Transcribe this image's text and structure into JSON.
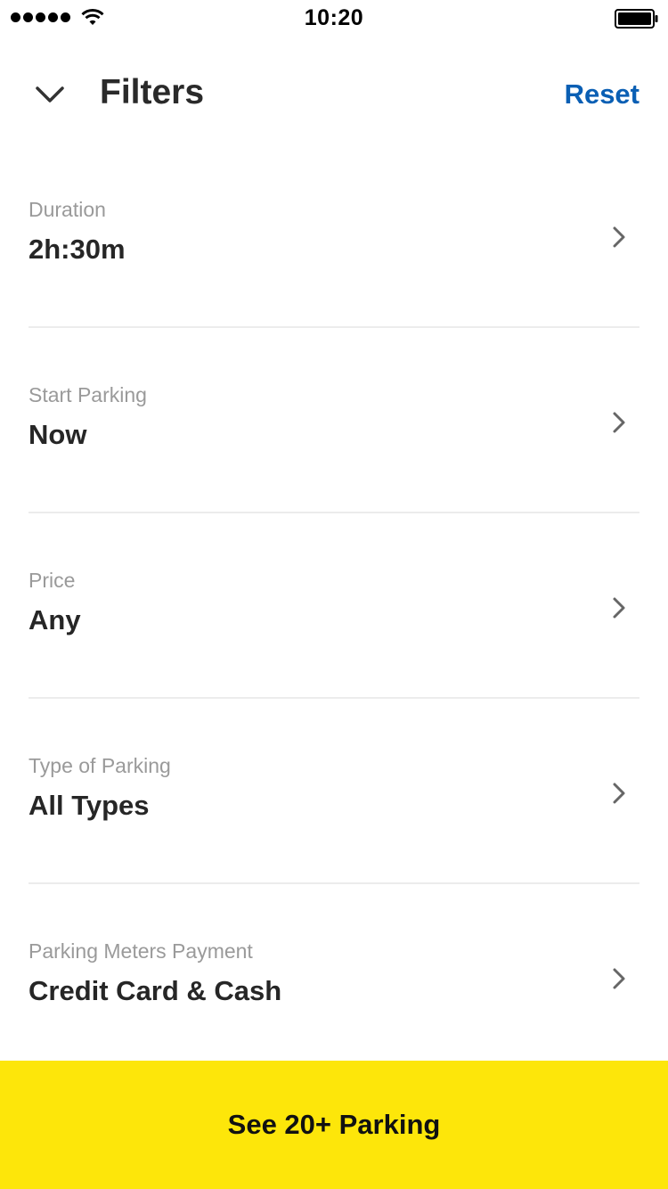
{
  "status_bar": {
    "time": "10:20",
    "signal_icon": "signal-dots-icon",
    "wifi_icon": "wifi-icon",
    "battery_icon": "battery-icon"
  },
  "header": {
    "collapse_icon": "chevron-down-icon",
    "title": "Filters",
    "reset_label": "Reset"
  },
  "filters": [
    {
      "label": "Duration",
      "value": "2h:30m"
    },
    {
      "label": "Start Parking",
      "value": "Now"
    },
    {
      "label": "Price",
      "value": "Any"
    },
    {
      "label": "Type of Parking",
      "value": "All Types"
    },
    {
      "label": "Parking Meters Payment",
      "value": "Credit Card & Cash"
    }
  ],
  "cta": {
    "label": "See 20+ Parking"
  },
  "colors": {
    "accent_blue": "#0a5fb4",
    "cta_yellow": "#fde60a",
    "label_gray": "#9a9a9a",
    "divider": "#ececec"
  }
}
